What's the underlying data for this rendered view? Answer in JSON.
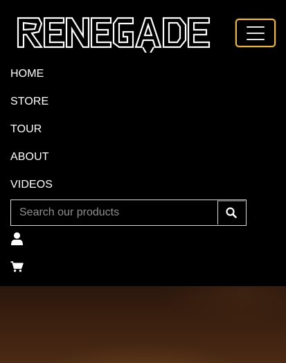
{
  "header": {
    "logo_text": "RENEGADE",
    "menu_toggle_label": "Toggle navigation"
  },
  "nav": {
    "items": [
      {
        "label": "HOME"
      },
      {
        "label": "STORE"
      },
      {
        "label": "TOUR"
      },
      {
        "label": "ABOUT"
      },
      {
        "label": "VIDEOS"
      }
    ]
  },
  "search": {
    "placeholder": "Search our products",
    "value": "",
    "button_icon": "search-icon"
  },
  "account": {
    "icon": "user-icon"
  },
  "cart": {
    "icon": "cart-icon"
  },
  "colors": {
    "background": "#000000",
    "toggler_border": "#e8b64f",
    "text": "#ffffff",
    "hero": "#3a1f0f"
  }
}
